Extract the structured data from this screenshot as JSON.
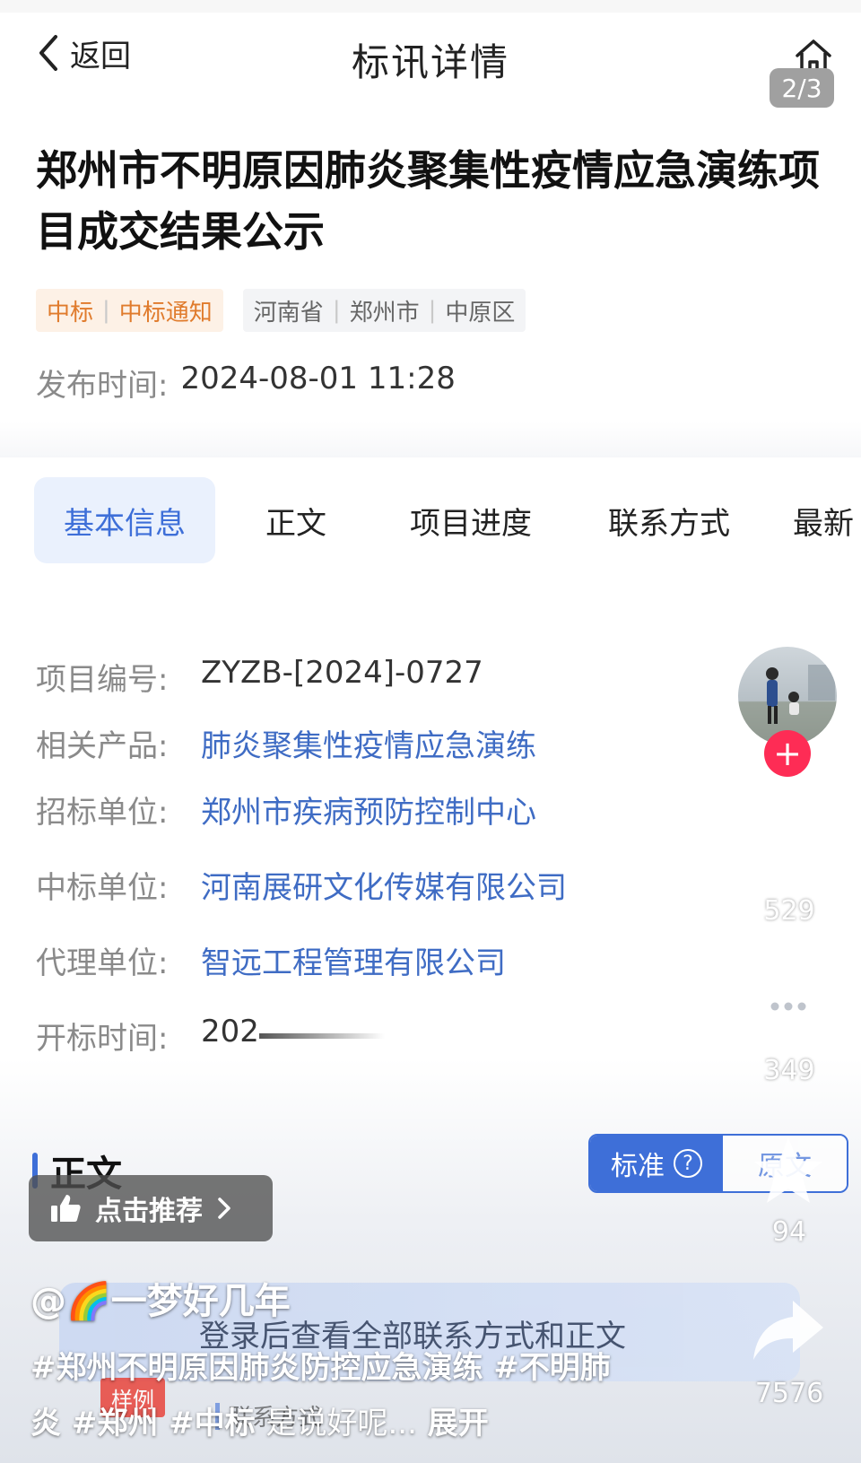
{
  "topbar": {
    "back_label": "返回",
    "title": "标讯详情",
    "page_indicator": "2/3"
  },
  "notice": {
    "title": "郑州市不明原因肺炎聚集性疫情应急演练项目成交结果公示",
    "tag_type": [
      "中标",
      "中标通知"
    ],
    "tag_region": [
      "河南省",
      "郑州市",
      "中原区"
    ],
    "publish_label": "发布时间:",
    "publish_time": "2024-08-01 11:28"
  },
  "tabs": [
    "基本信息",
    "正文",
    "项目进度",
    "联系方式",
    "最新"
  ],
  "info": [
    {
      "label": "项目编号:",
      "value": "ZYZB-[2024]-0727"
    },
    {
      "label": "相关产品:",
      "value": "肺炎聚集性疫情应急演练"
    },
    {
      "label": "招标单位:",
      "value": "郑州市疾病预防控制中心"
    },
    {
      "label": "中标单位:",
      "value": "河南展研文化传媒有限公司"
    },
    {
      "label": "代理单位:",
      "value": "智远工程管理有限公司"
    },
    {
      "label": "开标时间:",
      "value": "202"
    }
  ],
  "body_section": {
    "heading": "正文",
    "mode_standard": "标准",
    "mode_original": "原文",
    "login_prompt": "登录后查看全部联系方式和正文",
    "sample_badge": "样例",
    "contact_heading": "联系方式"
  },
  "overlay": {
    "recommend_label": "点击推荐",
    "username": "@🌈一梦好几年",
    "hashtags": "#郑州不明原因肺炎防控应急演练 #不明肺炎 #郑州 #中标",
    "caption_text": "是说好呢...",
    "expand_label": "展开"
  },
  "rail": {
    "likes": "529",
    "comments": "349",
    "favorites": "94",
    "shares": "7576"
  },
  "colors": {
    "accent_blue": "#3e6fd8",
    "tag_orange": "#e07b2c",
    "follow_red": "#fe2c55"
  }
}
